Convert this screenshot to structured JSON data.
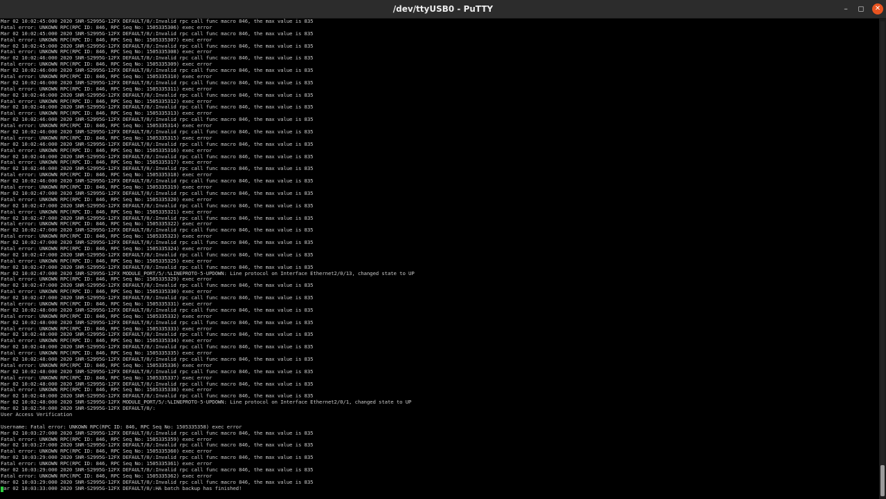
{
  "window": {
    "title": "/dev/ttyUSB0 - PuTTY",
    "minimize_glyph": "–",
    "maximize_glyph": "◻",
    "close_glyph": "✕"
  },
  "terminal": {
    "lines": [
      "Mar 02 10:02:45:000 2020 SNR-S2995G-12FX DEFAULT/8/:Invalid rpc call func macro 846, the max value is 835",
      "Fatal error: UNKOWN RPC(RPC ID: 846, RPC Seq No: 1505335306) exec error",
      "Mar 02 10:02:45:000 2020 SNR-S2995G-12FX DEFAULT/8/:Invalid rpc call func macro 846, the max value is 835",
      "Fatal error: UNKOWN RPC(RPC ID: 846, RPC Seq No: 1505335307) exec error",
      "Mar 02 10:02:45:000 2020 SNR-S2995G-12FX DEFAULT/8/:Invalid rpc call func macro 846, the max value is 835",
      "Fatal error: UNKOWN RPC(RPC ID: 846, RPC Seq No: 1505335308) exec error",
      "Mar 02 10:02:46:000 2020 SNR-S2995G-12FX DEFAULT/8/:Invalid rpc call func macro 846, the max value is 835",
      "Fatal error: UNKOWN RPC(RPC ID: 846, RPC Seq No: 1505335309) exec error",
      "Mar 02 10:02:46:000 2020 SNR-S2995G-12FX DEFAULT/8/:Invalid rpc call func macro 846, the max value is 835",
      "Fatal error: UNKOWN RPC(RPC ID: 846, RPC Seq No: 1505335310) exec error",
      "Mar 02 10:02:46:000 2020 SNR-S2995G-12FX DEFAULT/8/:Invalid rpc call func macro 846, the max value is 835",
      "Fatal error: UNKOWN RPC(RPC ID: 846, RPC Seq No: 1505335311) exec error",
      "Mar 02 10:02:46:000 2020 SNR-S2995G-12FX DEFAULT/8/:Invalid rpc call func macro 846, the max value is 835",
      "Fatal error: UNKOWN RPC(RPC ID: 846, RPC Seq No: 1505335312) exec error",
      "Mar 02 10:02:46:000 2020 SNR-S2995G-12FX DEFAULT/8/:Invalid rpc call func macro 846, the max value is 835",
      "Fatal error: UNKOWN RPC(RPC ID: 846, RPC Seq No: 1505335313) exec error",
      "Mar 02 10:02:46:000 2020 SNR-S2995G-12FX DEFAULT/8/:Invalid rpc call func macro 846, the max value is 835",
      "Fatal error: UNKOWN RPC(RPC ID: 846, RPC Seq No: 1505335314) exec error",
      "Mar 02 10:02:46:000 2020 SNR-S2995G-12FX DEFAULT/8/:Invalid rpc call func macro 846, the max value is 835",
      "Fatal error: UNKOWN RPC(RPC ID: 846, RPC Seq No: 1505335315) exec error",
      "Mar 02 10:02:46:000 2020 SNR-S2995G-12FX DEFAULT/8/:Invalid rpc call func macro 846, the max value is 835",
      "Fatal error: UNKOWN RPC(RPC ID: 846, RPC Seq No: 1505335316) exec error",
      "Mar 02 10:02:46:000 2020 SNR-S2995G-12FX DEFAULT/8/:Invalid rpc call func macro 846, the max value is 835",
      "Fatal error: UNKOWN RPC(RPC ID: 846, RPC Seq No: 1505335317) exec error",
      "Mar 02 10:02:46:000 2020 SNR-S2995G-12FX DEFAULT/8/:Invalid rpc call func macro 846, the max value is 835",
      "Fatal error: UNKOWN RPC(RPC ID: 846, RPC Seq No: 1505335318) exec error",
      "Mar 02 10:02:46:000 2020 SNR-S2995G-12FX DEFAULT/8/:Invalid rpc call func macro 846, the max value is 835",
      "Fatal error: UNKOWN RPC(RPC ID: 846, RPC Seq No: 1505335319) exec error",
      "Mar 02 10:02:47:000 2020 SNR-S2995G-12FX DEFAULT/8/:Invalid rpc call func macro 846, the max value is 835",
      "Fatal error: UNKOWN RPC(RPC ID: 846, RPC Seq No: 1505335320) exec error",
      "Mar 02 10:02:47:000 2020 SNR-S2995G-12FX DEFAULT/8/:Invalid rpc call func macro 846, the max value is 835",
      "Fatal error: UNKOWN RPC(RPC ID: 846, RPC Seq No: 1505335321) exec error",
      "Mar 02 10:02:47:000 2020 SNR-S2995G-12FX DEFAULT/8/:Invalid rpc call func macro 846, the max value is 835",
      "Fatal error: UNKOWN RPC(RPC ID: 846, RPC Seq No: 1505335322) exec error",
      "Mar 02 10:02:47:000 2020 SNR-S2995G-12FX DEFAULT/8/:Invalid rpc call func macro 846, the max value is 835",
      "Fatal error: UNKOWN RPC(RPC ID: 846, RPC Seq No: 1505335323) exec error",
      "Mar 02 10:02:47:000 2020 SNR-S2995G-12FX DEFAULT/8/:Invalid rpc call func macro 846, the max value is 835",
      "Fatal error: UNKOWN RPC(RPC ID: 846, RPC Seq No: 1505335324) exec error",
      "Mar 02 10:02:47:000 2020 SNR-S2995G-12FX DEFAULT/8/:Invalid rpc call func macro 846, the max value is 835",
      "Fatal error: UNKOWN RPC(RPC ID: 846, RPC Seq No: 1505335325) exec error",
      "Mar 02 10:02:47:000 2020 SNR-S2995G-12FX DEFAULT/8/:Invalid rpc call func macro 846, the max value is 835",
      "Mar 02 10:02:47:000 2020 SNR-S2995G-12FX MODULE_PORT/5/:%LINEPROTO-5-UPDOWN: Line protocol on Interface Ethernet2/0/13, changed state to UP",
      "Fatal error: UNKOWN RPC(RPC ID: 846, RPC Seq No: 1505335329) exec error",
      "Mar 02 10:02:47:000 2020 SNR-S2995G-12FX DEFAULT/8/:Invalid rpc call func macro 846, the max value is 835",
      "Fatal error: UNKOWN RPC(RPC ID: 846, RPC Seq No: 1505335330) exec error",
      "Mar 02 10:02:47:000 2020 SNR-S2995G-12FX DEFAULT/8/:Invalid rpc call func macro 846, the max value is 835",
      "Fatal error: UNKOWN RPC(RPC ID: 846, RPC Seq No: 1505335331) exec error",
      "Mar 02 10:02:48:000 2020 SNR-S2995G-12FX DEFAULT/8/:Invalid rpc call func macro 846, the max value is 835",
      "Fatal error: UNKOWN RPC(RPC ID: 846, RPC Seq No: 1505335332) exec error",
      "Mar 02 10:02:48:000 2020 SNR-S2995G-12FX DEFAULT/8/:Invalid rpc call func macro 846, the max value is 835",
      "Fatal error: UNKOWN RPC(RPC ID: 846, RPC Seq No: 1505335333) exec error",
      "Mar 02 10:02:48:000 2020 SNR-S2995G-12FX DEFAULT/8/:Invalid rpc call func macro 846, the max value is 835",
      "Fatal error: UNKOWN RPC(RPC ID: 846, RPC Seq No: 1505335334) exec error",
      "Mar 02 10:02:48:000 2020 SNR-S2995G-12FX DEFAULT/8/:Invalid rpc call func macro 846, the max value is 835",
      "Fatal error: UNKOWN RPC(RPC ID: 846, RPC Seq No: 1505335335) exec error",
      "Mar 02 10:02:48:000 2020 SNR-S2995G-12FX DEFAULT/8/:Invalid rpc call func macro 846, the max value is 835",
      "Fatal error: UNKOWN RPC(RPC ID: 846, RPC Seq No: 1505335336) exec error",
      "Mar 02 10:02:48:000 2020 SNR-S2995G-12FX DEFAULT/8/:Invalid rpc call func macro 846, the max value is 835",
      "Fatal error: UNKOWN RPC(RPC ID: 846, RPC Seq No: 1505335337) exec error",
      "Mar 02 10:02:48:000 2020 SNR-S2995G-12FX DEFAULT/8/:Invalid rpc call func macro 846, the max value is 835",
      "Fatal error: UNKOWN RPC(RPC ID: 846, RPC Seq No: 1505335338) exec error",
      "Mar 02 10:02:48:000 2020 SNR-S2995G-12FX DEFAULT/8/:Invalid rpc call func macro 846, the max value is 835",
      "Mar 02 10:02:48:000 2020 SNR-S2995G-12FX MODULE_PORT/5/:%LINEPROTO-5-UPDOWN: Line protocol on Interface Ethernet2/0/1, changed state to UP",
      "Mar 02 10:02:50:000 2020 SNR-S2995G-12FX DEFAULT/8/:",
      "User Access Verification",
      "",
      "Username: Fatal error: UNKOWN RPC(RPC ID: 846, RPC Seq No: 1505335358) exec error",
      "Mar 02 10:03:27:000 2020 SNR-S2995G-12FX DEFAULT/8/:Invalid rpc call func macro 846, the max value is 835",
      "Fatal error: UNKOWN RPC(RPC ID: 846, RPC Seq No: 1505335359) exec error",
      "Mar 02 10:03:27:000 2020 SNR-S2995G-12FX DEFAULT/8/:Invalid rpc call func macro 846, the max value is 835",
      "Fatal error: UNKOWN RPC(RPC ID: 846, RPC Seq No: 1505335360) exec error",
      "Mar 02 10:03:29:000 2020 SNR-S2995G-12FX DEFAULT/8/:Invalid rpc call func macro 846, the max value is 835",
      "Fatal error: UNKOWN RPC(RPC ID: 846, RPC Seq No: 1505335361) exec error",
      "Mar 02 10:03:29:000 2020 SNR-S2995G-12FX DEFAULT/8/:Invalid rpc call func macro 846, the max value is 835",
      "Fatal error: UNKOWN RPC(RPC ID: 846, RPC Seq No: 1505335362) exec error",
      "Mar 02 10:03:29:000 2020 SNR-S2995G-12FX DEFAULT/8/:Invalid rpc call func macro 846, the max value is 835",
      "Mar 02 10:03:33:000 2020 SNR-S2995G-12FX DEFAULT/8/:HA batch backup has finished!"
    ],
    "cursor_color": "#2ecc40",
    "text_color": "#c8c8c8",
    "background_color": "#000000"
  },
  "scrollbar": {
    "position_fraction": 0.94
  }
}
